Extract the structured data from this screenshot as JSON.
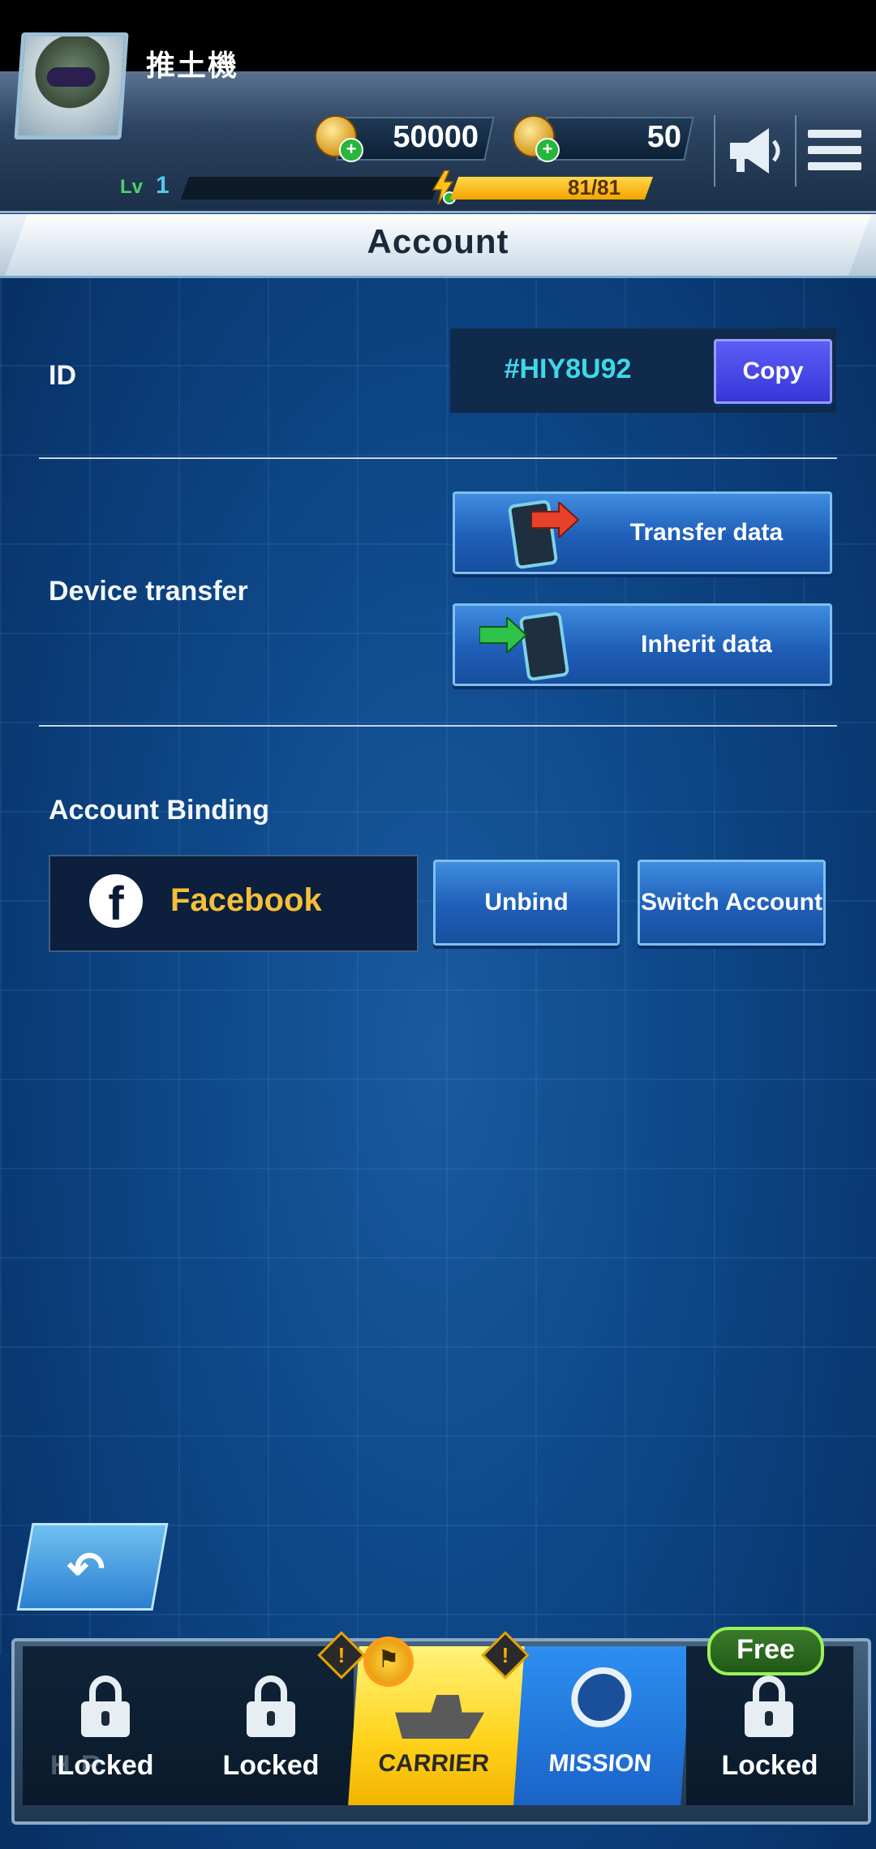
{
  "header": {
    "player_name": "推土機",
    "level_prefix": "Lv",
    "level": "1",
    "energy": "81/81",
    "coins": "50000",
    "tokens": "50"
  },
  "page": {
    "title": "Account"
  },
  "id_section": {
    "label": "ID",
    "value": "#HIY8U92",
    "copy_label": "Copy"
  },
  "device_transfer": {
    "label": "Device transfer",
    "transfer_label": "Transfer data",
    "inherit_label": "Inherit data"
  },
  "account_binding": {
    "label": "Account Binding",
    "provider": "Facebook",
    "unbind_label": "Unbind",
    "switch_label": "Switch Account"
  },
  "bottom_nav": {
    "tabs": [
      {
        "label": "Locked",
        "dim_text": "H         R"
      },
      {
        "label": "Locked"
      },
      {
        "label": "CARRIER"
      },
      {
        "label": "MISSION"
      },
      {
        "label": "Locked",
        "badge": "Free"
      }
    ]
  },
  "icons": {
    "back": "back-arrow-icon",
    "announce": "megaphone-icon",
    "menu": "hamburger-menu-icon",
    "lock": "lock-icon",
    "facebook": "facebook-icon"
  },
  "colors": {
    "accent_cyan": "#41d7e8",
    "facebook_gold": "#f4bf3a",
    "copy_purple": "#3737d8",
    "carrier_yellow": "#ffd21a",
    "mission_blue": "#1a63c8"
  }
}
